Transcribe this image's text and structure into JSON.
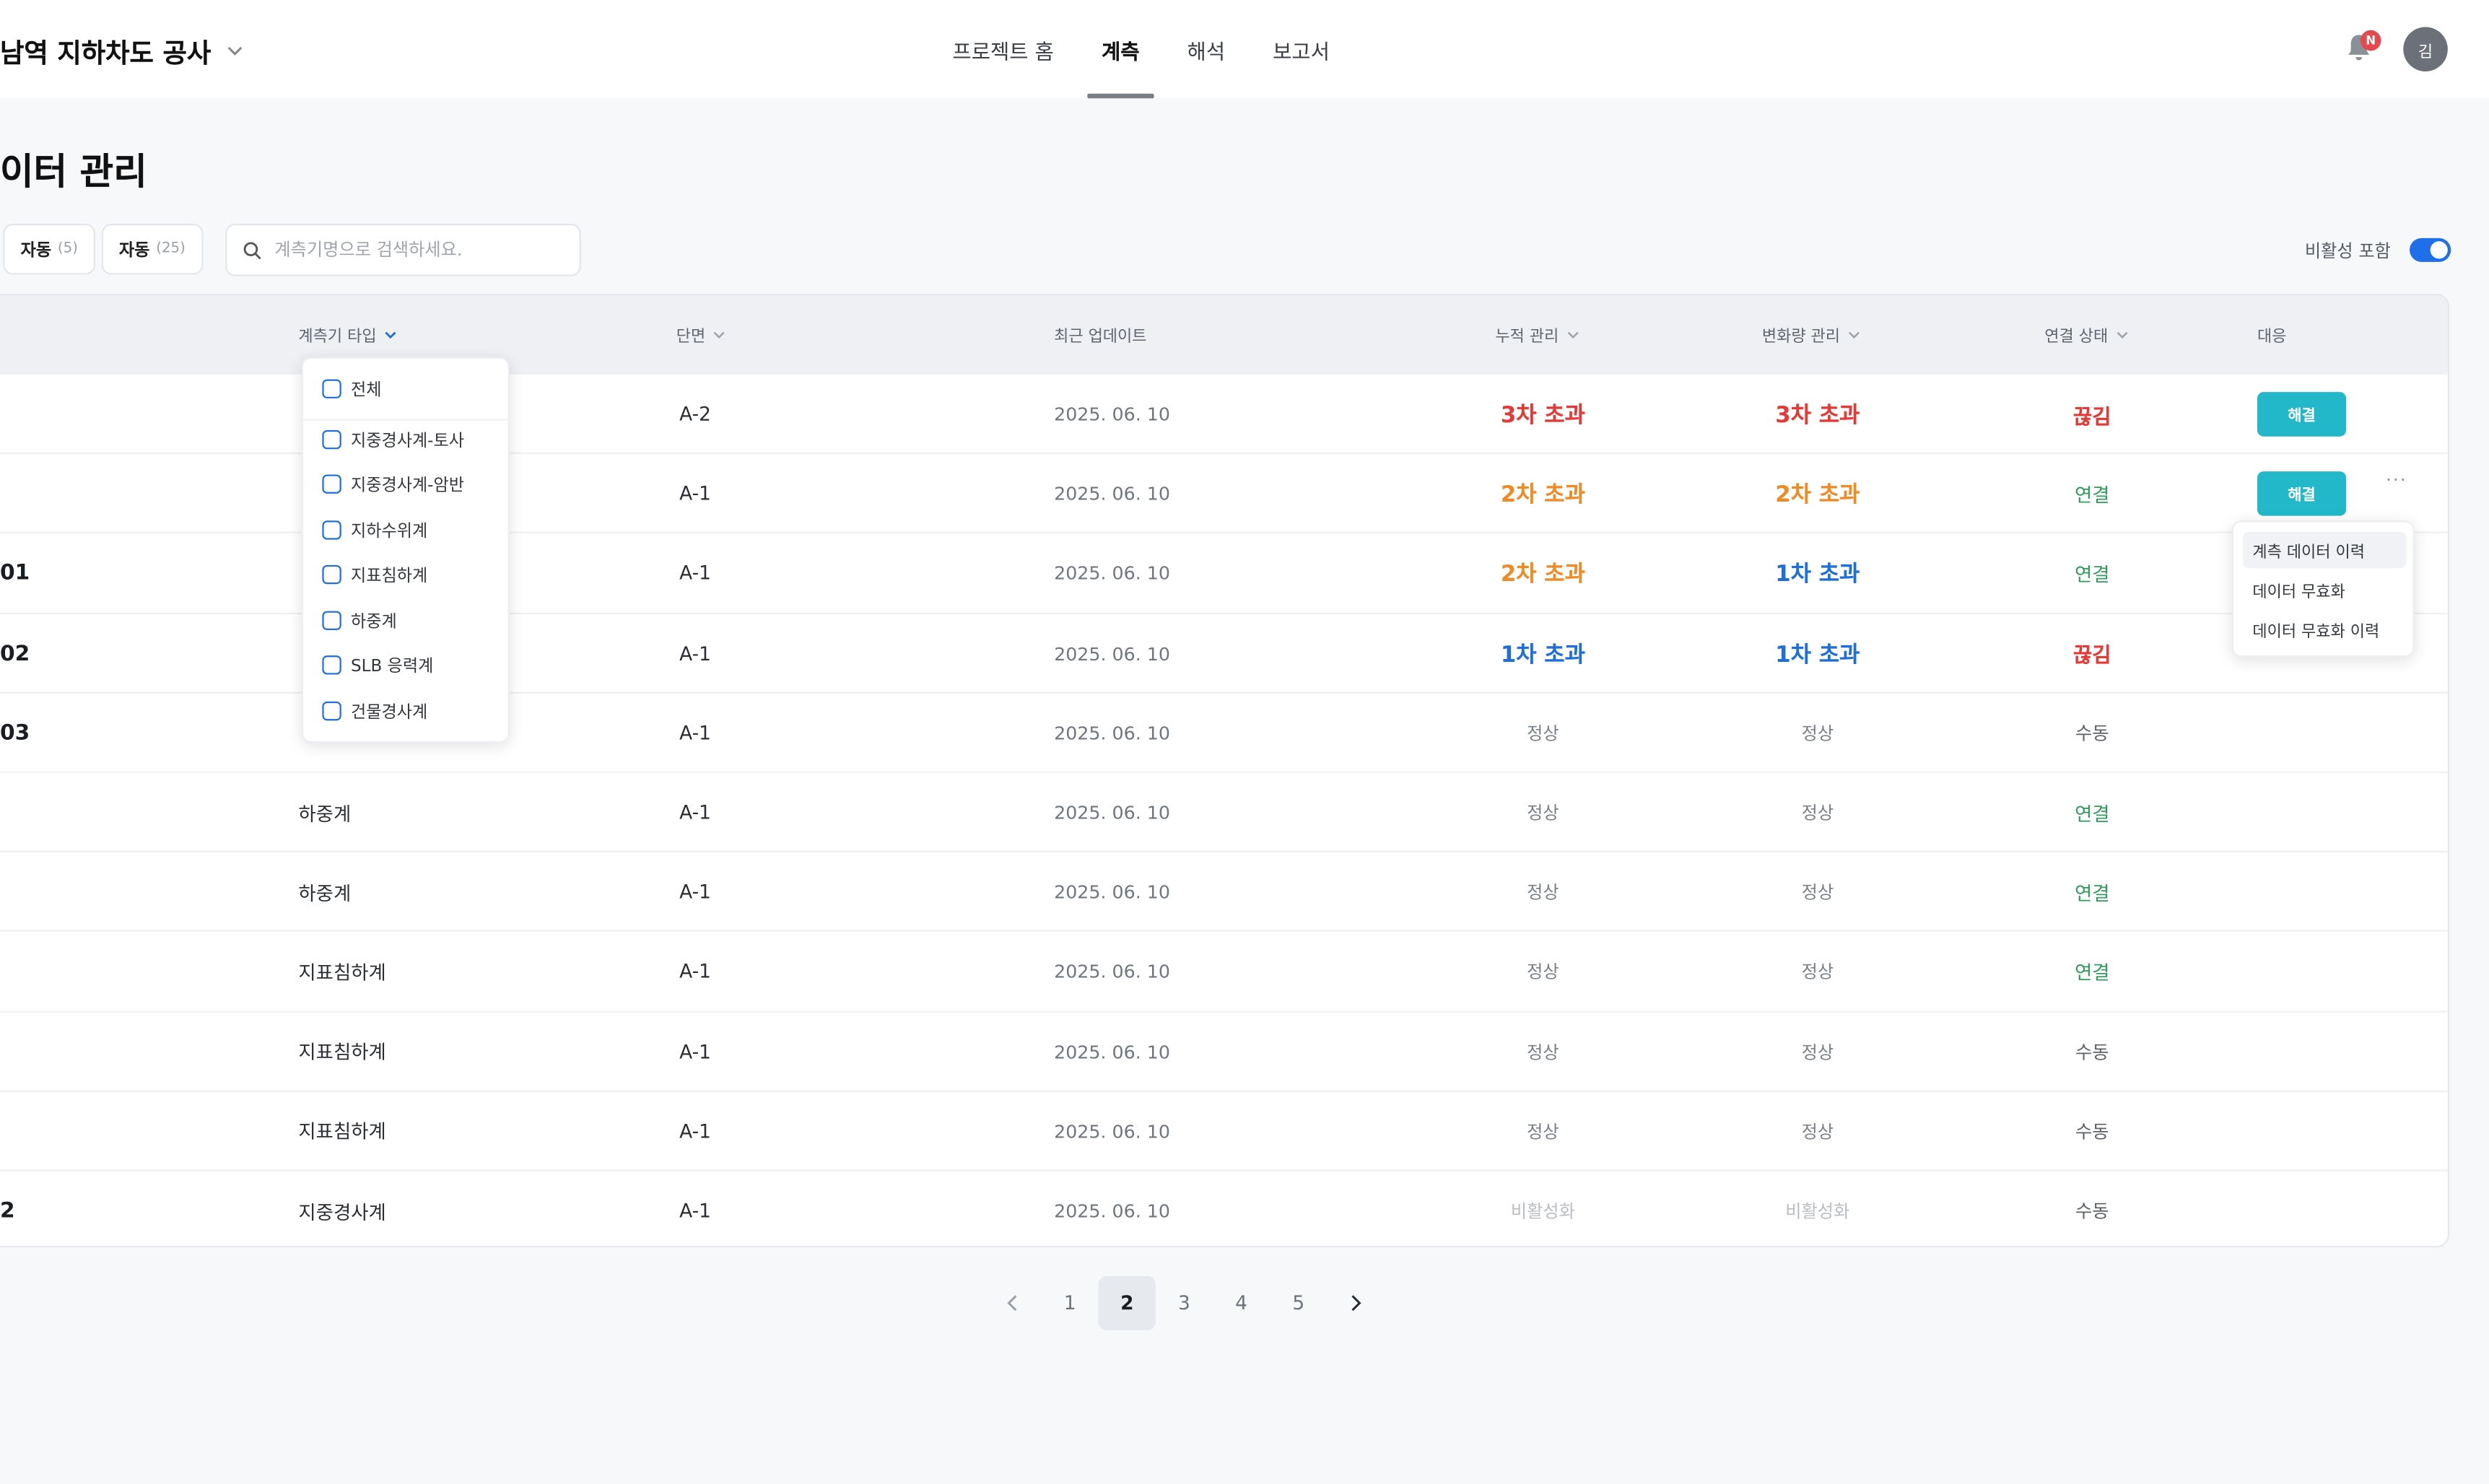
{
  "header": {
    "project_name": "남역 지하차도 공사",
    "tabs": [
      "프로젝트 홈",
      "계측",
      "해석",
      "보고서"
    ],
    "active_tab": "계측",
    "notification_badge": "N",
    "avatar_initial": "김"
  },
  "page": {
    "title": "이터 관리",
    "chips": [
      {
        "label": "자동",
        "count": "(5)"
      },
      {
        "label": "자동",
        "count": "(25)"
      }
    ],
    "search": {
      "placeholder": "계측기명으로 검색하세요."
    },
    "inactive_toggle_label": "비활성 포함",
    "inactive_toggle_on": true
  },
  "table": {
    "columns": {
      "type": "계측기 타입",
      "section": "단면",
      "updated": "최근 업데이트",
      "cumulative": "누적 관리",
      "change": "변화량 관리",
      "connection": "연결 상태",
      "action": "대응"
    },
    "rows": [
      {
        "name": "",
        "type": "",
        "section": "A-2",
        "date": "2025. 06. 10",
        "cumulative": "3차 초과",
        "change": "3차 초과",
        "connection": "끊김",
        "action": "해결"
      },
      {
        "name": "",
        "type": "",
        "section": "A-1",
        "date": "2025. 06. 10",
        "cumulative": "2차 초과",
        "change": "2차 초과",
        "connection": "연결",
        "action": "해결"
      },
      {
        "name": "01",
        "type": "",
        "section": "A-1",
        "date": "2025. 06. 10",
        "cumulative": "2차 초과",
        "change": "1차 초과",
        "connection": "연결",
        "action": ""
      },
      {
        "name": "02",
        "type": "",
        "section": "A-1",
        "date": "2025. 06. 10",
        "cumulative": "1차 초과",
        "change": "1차 초과",
        "connection": "끊김",
        "action": ""
      },
      {
        "name": "03",
        "type": "",
        "section": "A-1",
        "date": "2025. 06. 10",
        "cumulative": "정상",
        "change": "정상",
        "connection": "수동",
        "action": ""
      },
      {
        "name": "",
        "type": "하중계",
        "section": "A-1",
        "date": "2025. 06. 10",
        "cumulative": "정상",
        "change": "정상",
        "connection": "연결",
        "action": ""
      },
      {
        "name": "",
        "type": "하중계",
        "section": "A-1",
        "date": "2025. 06. 10",
        "cumulative": "정상",
        "change": "정상",
        "connection": "연결",
        "action": ""
      },
      {
        "name": "",
        "type": "지표침하계",
        "section": "A-1",
        "date": "2025. 06. 10",
        "cumulative": "정상",
        "change": "정상",
        "connection": "연결",
        "action": ""
      },
      {
        "name": "",
        "type": "지표침하계",
        "section": "A-1",
        "date": "2025. 06. 10",
        "cumulative": "정상",
        "change": "정상",
        "connection": "수동",
        "action": ""
      },
      {
        "name": "",
        "type": "지표침하계",
        "section": "A-1",
        "date": "2025. 06. 10",
        "cumulative": "정상",
        "change": "정상",
        "connection": "수동",
        "action": ""
      },
      {
        "name": "2",
        "type": "지중경사계",
        "section": "A-1",
        "date": "2025. 06. 10",
        "cumulative": "비활성화",
        "change": "비활성화",
        "connection": "수동",
        "action": ""
      }
    ],
    "row_more_label": "···"
  },
  "type_filter": {
    "items": [
      "전체",
      "지중경사계-토사",
      "지중경사계-암반",
      "지하수위계",
      "지표침하계",
      "하중계",
      "SLB 응력계",
      "건물경사계"
    ]
  },
  "context_menu": {
    "items": [
      "계측 데이터 이력",
      "데이터 무효화",
      "데이터 무효화 이력"
    ]
  },
  "pagination": {
    "pages": [
      "1",
      "2",
      "3",
      "4",
      "5"
    ],
    "current": "2"
  },
  "colors": {
    "accent": "#1f6feb",
    "resolve_button": "#22b8c9",
    "alert3": "#e53935",
    "alert2": "#f08a24",
    "alert1": "#1e6fd9",
    "connected": "#2e9d5b"
  }
}
